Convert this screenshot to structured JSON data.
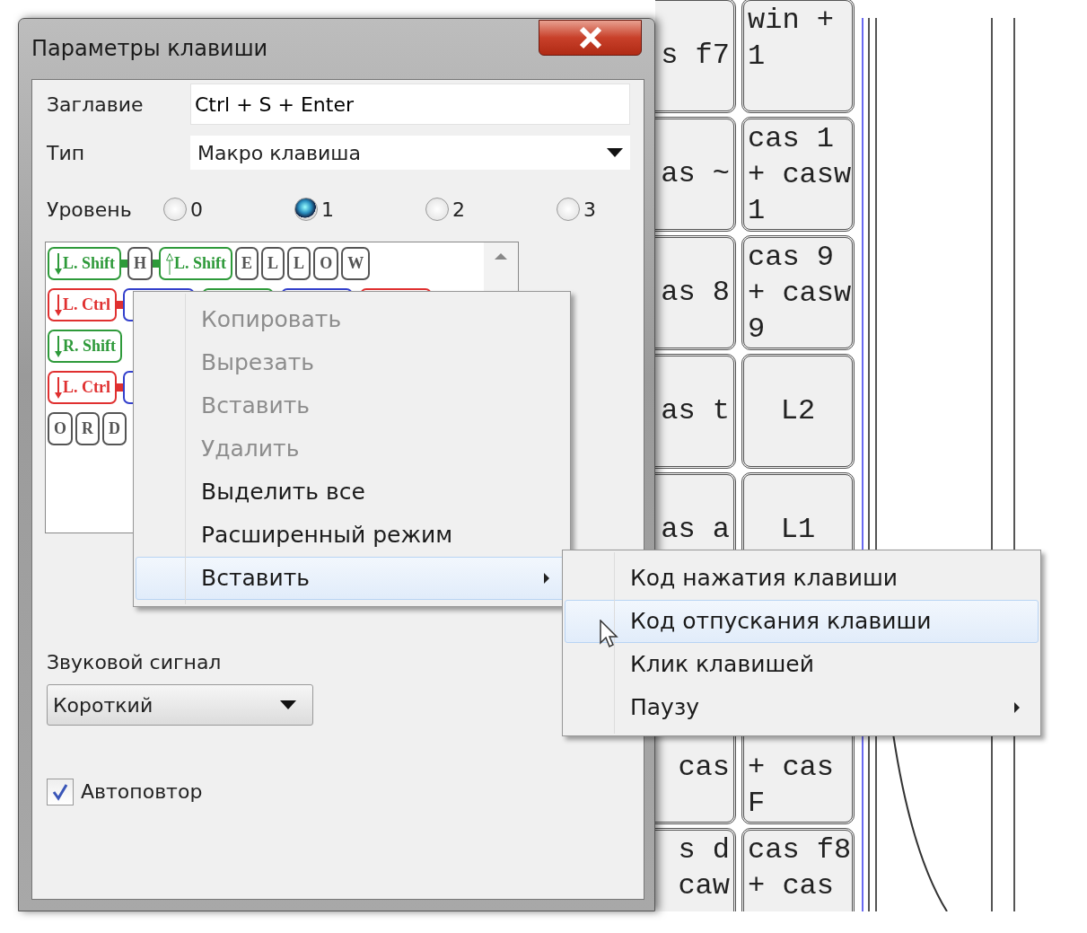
{
  "dialog": {
    "title": "Параметры клавиши",
    "fields": [
      {
        "label": "Заглавие",
        "kind": "text",
        "value": "Ctrl + S + Enter"
      },
      {
        "label": "Тип",
        "kind": "select",
        "value": "Макро клавиша"
      }
    ],
    "level": {
      "label": "Уровень",
      "options": [
        {
          "label": "0",
          "selected": false
        },
        {
          "label": "1",
          "selected": true
        },
        {
          "label": "2",
          "selected": false
        },
        {
          "label": "3",
          "selected": false
        }
      ]
    },
    "macro_rows": [
      [
        {
          "kind": "key",
          "label": "L. Shift",
          "pressed": true,
          "color": "#2e9a3a"
        },
        {
          "kind": "link",
          "color": "#2e9a3a"
        },
        {
          "kind": "key",
          "label": "H",
          "color": "#555555"
        },
        {
          "kind": "link",
          "color": "#2e9a3a"
        },
        {
          "kind": "key",
          "label": "L. Shift",
          "pressed": false,
          "color": "#2e9a3a"
        },
        {
          "kind": "key",
          "label": "E",
          "color": "#555555"
        },
        {
          "kind": "key",
          "label": "L",
          "color": "#555555"
        },
        {
          "kind": "key",
          "label": "L",
          "color": "#555555"
        },
        {
          "kind": "key",
          "label": "O",
          "color": "#555555"
        },
        {
          "kind": "key",
          "label": "W",
          "color": "#555555"
        }
      ],
      [
        {
          "kind": "key",
          "label": "L. Ctrl",
          "pressed": true,
          "color": "#e03030"
        },
        {
          "kind": "link",
          "color": "#e03030"
        },
        {
          "kind": "key",
          "color": "#3340cc"
        },
        {
          "kind": "key",
          "color": "#2e9a3a"
        },
        {
          "kind": "key",
          "color": "#3340cc"
        },
        {
          "kind": "key",
          "color": "#e03030"
        }
      ],
      [
        {
          "kind": "key",
          "label": "R. Shift",
          "pressed": true,
          "color": "#2e9a3a"
        }
      ],
      [
        {
          "kind": "key",
          "label": "L. Ctrl",
          "pressed": true,
          "color": "#e03030"
        },
        {
          "kind": "link",
          "color": "#e03030"
        },
        {
          "kind": "key",
          "color": "#3340cc"
        }
      ],
      [
        {
          "kind": "key",
          "label": "O",
          "color": "#555555"
        },
        {
          "kind": "key",
          "label": "R",
          "color": "#555555"
        },
        {
          "kind": "key",
          "label": "D",
          "color": "#555555"
        }
      ]
    ],
    "beep": {
      "label": "Звуковой сигнал",
      "value": "Короткий"
    },
    "autorepeat": {
      "label": "Автоповтор",
      "checked": true
    }
  },
  "context_menu": {
    "items": [
      {
        "label": "Копировать",
        "disabled": true,
        "highlighted": false,
        "submenu": false
      },
      {
        "label": "Вырезать",
        "disabled": true,
        "highlighted": false,
        "submenu": false
      },
      {
        "label": "Вставить",
        "disabled": true,
        "highlighted": false,
        "submenu": false
      },
      {
        "label": "Удалить",
        "disabled": true,
        "highlighted": false,
        "submenu": false
      },
      {
        "label": "Выделить все",
        "disabled": false,
        "highlighted": false,
        "submenu": false
      },
      {
        "label": "Расширенный режим",
        "disabled": false,
        "highlighted": false,
        "submenu": false
      },
      {
        "label": "Вставить",
        "disabled": false,
        "highlighted": true,
        "submenu": true
      }
    ]
  },
  "submenu": {
    "items": [
      {
        "label": "Код нажатия клавиши",
        "highlighted": false,
        "submenu": false
      },
      {
        "label": "Код отпускания клавиши",
        "highlighted": true,
        "submenu": false
      },
      {
        "label": "Клик клавишей",
        "highlighted": false,
        "submenu": false
      },
      {
        "label": "Паузу",
        "highlighted": false,
        "submenu": true
      }
    ]
  },
  "key_rows": [
    [
      {
        "lines": [
          "s f7"
        ]
      },
      {
        "lines": [
          "win +",
          "1"
        ]
      }
    ],
    [
      {
        "lines": [
          "as ~"
        ]
      },
      {
        "lines": [
          "cas 1",
          "+ casw",
          "1"
        ]
      }
    ],
    [
      {
        "lines": [
          "as 8"
        ]
      },
      {
        "lines": [
          "cas 9",
          "+ casw",
          "9"
        ]
      }
    ],
    [
      {
        "lines": [
          "as t"
        ]
      },
      {
        "lines": [
          "L2"
        ]
      }
    ],
    [
      {
        "lines": [
          "as a"
        ]
      },
      {
        "lines": [
          "L1"
        ]
      }
    ],
    [
      {
        "lines": [
          "cas"
        ]
      },
      {
        "lines": [
          "+ cas",
          "F"
        ]
      }
    ],
    [
      {
        "lines": [
          "s d",
          "caw"
        ]
      },
      {
        "lines": [
          "cas f8",
          "+ cas"
        ]
      }
    ]
  ]
}
